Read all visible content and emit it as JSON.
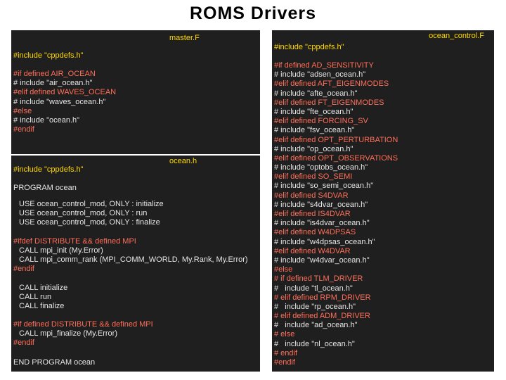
{
  "title": "ROMS  Drivers",
  "colors": {
    "panel_bg": "#1f1f1f",
    "label": "#ffd800",
    "keyword": "#ff6f5a",
    "text": "#e6e6e6"
  },
  "master": {
    "filename": "master.F",
    "include_line": "#include \"cppdefs.h\"",
    "lines": [
      "#if defined AIR_OCEAN",
      "# include \"air_ocean.h\"",
      "#elif defined WAVES_OCEAN",
      "# include \"waves_ocean.h\"",
      "#else",
      "# include \"ocean.h\"",
      "#endif"
    ]
  },
  "ocean": {
    "filename": "ocean.h",
    "include_line": "#include \"cppdefs.h\"",
    "program": "PROGRAM ocean",
    "uses": [
      "USE ocean_control_mod, ONLY : initialize",
      "USE ocean_control_mod, ONLY : run",
      "USE ocean_control_mod, ONLY : finalize"
    ],
    "ifdef": "#ifdef DISTRIBUTE && defined MPI",
    "mpi_calls": [
      "CALL mpi_init (My.Error)",
      "CALL mpi_comm_rank (MPI_COMM_WORLD, My.Rank, My.Error)"
    ],
    "endif1": "#endif",
    "calls": [
      "CALL initialize",
      "CALL run",
      "CALL finalize"
    ],
    "if2": "#if defined DISTRIBUTE && defined MPI",
    "finalize_call": "CALL mpi_finalize (My.Error)",
    "endif2": "#endif",
    "end": "END PROGRAM ocean"
  },
  "control": {
    "filename": "ocean_control.F",
    "include_line": "#include \"cppdefs.h\"",
    "lines": [
      "#if defined AD_SENSITIVITY",
      "# include \"adsen_ocean.h\"",
      "#elif defined AFT_EIGENMODES",
      "# include \"afte_ocean.h\"",
      "#elif defined FT_EIGENMODES",
      "# include \"fte_ocean.h\"",
      "#elif defined FORCING_SV",
      "# include \"fsv_ocean.h\"",
      "#elif defined OPT_PERTURBATION",
      "# include \"op_ocean.h\"",
      "#elif defined OPT_OBSERVATIONS",
      "# include \"optobs_ocean.h\"",
      "#elif defined SO_SEMI",
      "# include \"so_semi_ocean.h\"",
      "#elif defined S4DVAR",
      "# include \"s4dvar_ocean.h\"",
      "#elif defined IS4DVAR",
      "# include \"is4dvar_ocean.h\"",
      "#elif defined W4DPSAS",
      "# include \"w4dpsas_ocean.h\"",
      "#elif defined W4DVAR",
      "# include \"w4dvar_ocean.h\"",
      "#else",
      "# if defined TLM_DRIVER",
      "#   include \"tl_ocean.h\"",
      "# elif defined RPM_DRIVER",
      "#   include \"rp_ocean.h\"",
      "# elif defined ADM_DRIVER",
      "#   include \"ad_ocean.h\"",
      "# else",
      "#   include \"nl_ocean.h\"",
      "# endif",
      "#endif"
    ]
  }
}
